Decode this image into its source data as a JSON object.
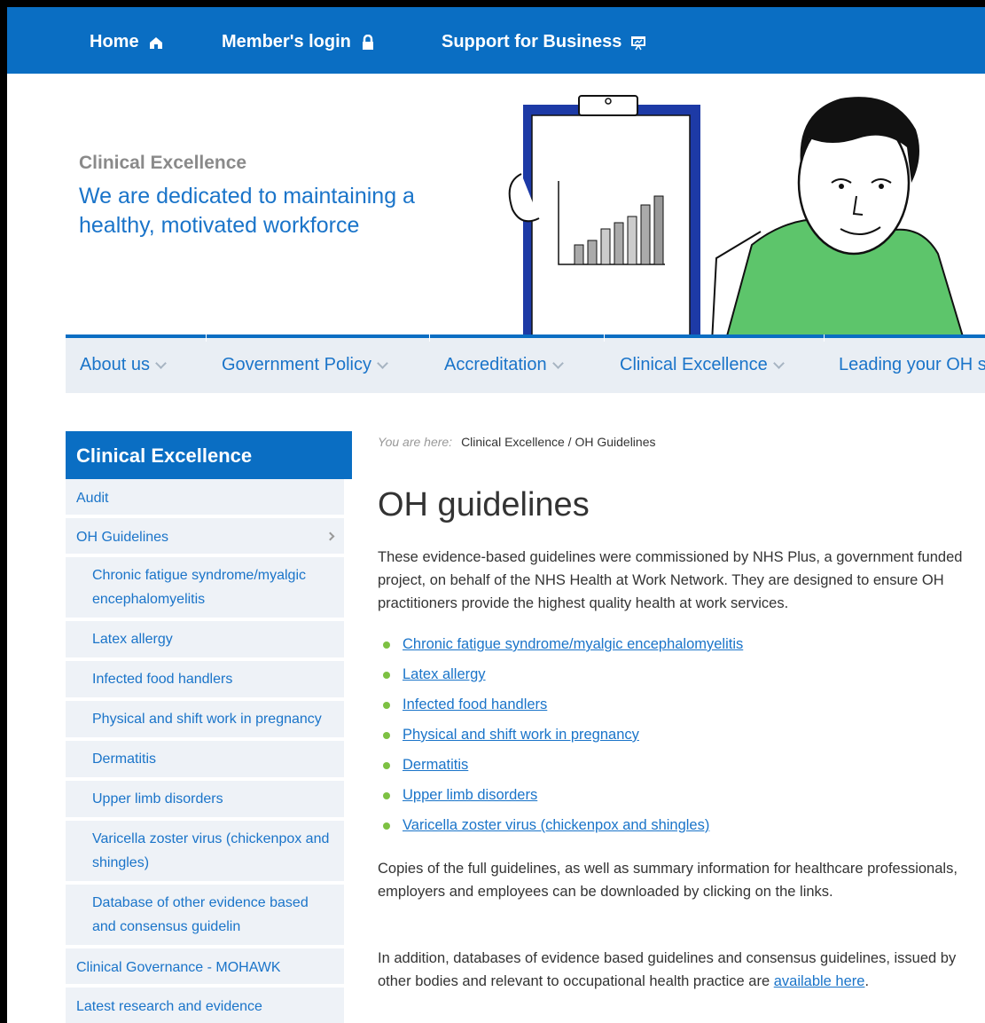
{
  "topbar": {
    "home": "Home",
    "login": "Member's login",
    "support": "Support for Business"
  },
  "header": {
    "kicker": "Clinical Excellence",
    "tagline": "We are dedicated to maintaining a healthy, motivated workforce"
  },
  "nav": {
    "items": [
      "About us",
      "Government Policy",
      "Accreditation",
      "Clinical Excellence",
      "Leading your OH s"
    ]
  },
  "sidebar": {
    "title": "Clinical Excellence",
    "items": [
      {
        "label": "Audit"
      },
      {
        "label": "OH Guidelines"
      },
      {
        "label": "Chronic fatigue syndrome/myalgic encephalomyelitis"
      },
      {
        "label": "Latex allergy"
      },
      {
        "label": "Infected food handlers"
      },
      {
        "label": "Physical and shift work in pregnancy"
      },
      {
        "label": "Dermatitis"
      },
      {
        "label": "Upper limb disorders"
      },
      {
        "label": "Varicella zoster virus (chickenpox and shingles)"
      },
      {
        "label": "Database of other evidence based and consensus guidelin"
      },
      {
        "label": "Clinical Governance - MOHAWK"
      },
      {
        "label": "Latest research and evidence"
      }
    ]
  },
  "breadcrumb": {
    "label": "You are here:",
    "path": "Clinical Excellence / OH Guidelines"
  },
  "main": {
    "title": "OH guidelines",
    "intro": "These evidence-based guidelines were commissioned by NHS Plus, a government funded project, on behalf of the NHS Health at Work Network. They are designed to ensure OH practitioners provide the highest quality health at work services.",
    "links": [
      "Chronic fatigue syndrome/myalgic encephalomyelitis",
      "Latex allergy",
      "Infected food handlers",
      "Physical and shift work in pregnancy",
      "Dermatitis",
      "Upper limb disorders",
      "Varicella zoster virus (chickenpox and shingles) "
    ],
    "copies": "Copies of the full guidelines, as well as summary information for healthcare professionals, employers and employees can be downloaded by clicking on the links.",
    "addition_text": "In addition, databases of evidence based guidelines and consensus guidelines, issued by other bodies and relevant to occupational health practice are ",
    "addition_link": "available here",
    "addition_end": "."
  },
  "colors": {
    "brand_blue": "#0a6ec3",
    "link_blue": "#1a74c9",
    "bullet_green": "#7dc143"
  }
}
